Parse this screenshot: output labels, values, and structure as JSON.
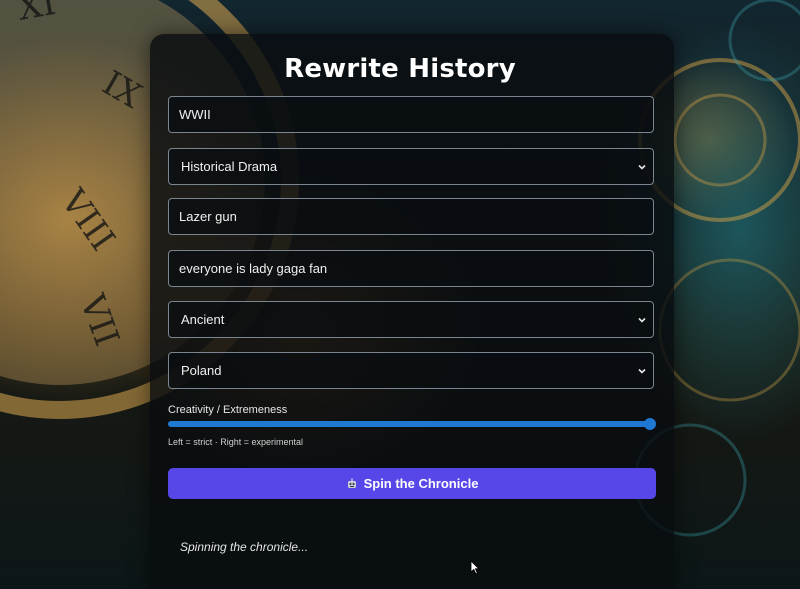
{
  "title": "Rewrite History",
  "fields": {
    "event_value": "WWII",
    "genre_selected": "Historical Drama",
    "twist_value": "Lazer gun",
    "detail_value": "everyone is lady gaga fan",
    "era_selected": "Ancient",
    "location_selected": "Poland"
  },
  "slider": {
    "label": "Creativity / Extremeness",
    "hint": "Left = strict · Right = experimental",
    "value_fraction": 1.0,
    "accent": "#1f78d1"
  },
  "button": {
    "label": "Spin the Chronicle",
    "icon": "robot-icon",
    "color": "#5747e8"
  },
  "status": {
    "text": "Spinning the chronicle..."
  },
  "icons": {
    "select_arrow": "chevron-down-icon",
    "cursor": "mouse-pointer-icon"
  }
}
